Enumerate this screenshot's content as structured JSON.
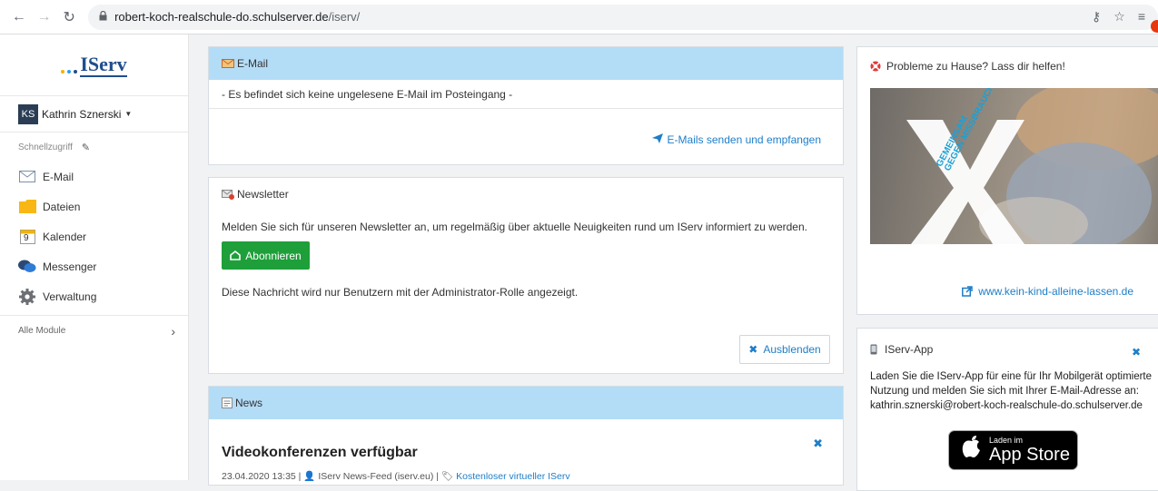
{
  "browser": {
    "url_host": "robert-koch-realschule-do.schulserver.de",
    "url_path": "/iserv/"
  },
  "sidebar": {
    "logo_text": "IServ",
    "user_initials": "KS",
    "user_name": "Kathrin Sznerski",
    "quick_access_label": "Schnellzugriff",
    "items": [
      {
        "label": "E-Mail",
        "icon": "envelope-icon"
      },
      {
        "label": "Dateien",
        "icon": "folder-icon"
      },
      {
        "label": "Kalender",
        "icon": "calendar-icon",
        "calendar_day": "9"
      },
      {
        "label": "Messenger",
        "icon": "chat-icon"
      },
      {
        "label": "Verwaltung",
        "icon": "gear-icon"
      }
    ],
    "all_modules_label": "Alle Module"
  },
  "email": {
    "title": "E-Mail",
    "status": "- Es befindet sich keine ungelesene E-Mail im Posteingang -",
    "link": "E-Mails senden und empfangen"
  },
  "newsletter": {
    "title": "Newsletter",
    "text": "Melden Sie sich für unseren Newsletter an, um regelmäßig über aktuelle Neuigkeiten rund um IServ informiert zu werden.",
    "subscribe_label": "Abonnieren",
    "admin_note": "Diese Nachricht wird nur Benutzern mit der Administrator-Rolle angezeigt.",
    "hide_label": "Ausblenden"
  },
  "news": {
    "title": "News",
    "headline": "Videokonferenzen verfügbar",
    "date": "23.04.2020 13:35 |",
    "author": "IServ News-Feed (iserv.eu) |",
    "tag": "Kostenloser virtueller IServ"
  },
  "help": {
    "title": "Probleme zu Hause? Lass dir helfen!",
    "image_caption_1": "GEMEINSAM",
    "image_caption_2": "GEGEN MISSBRAUCH",
    "link": "www.kein-kind-alleine-lassen.de"
  },
  "app": {
    "title": "IServ-App",
    "text_line_1": "Laden Sie die IServ-App für eine für Ihr Mobilgerät optimierte",
    "text_line_2": "Nutzung und melden Sie sich mit Ihrer E-Mail-Adresse an:",
    "text_line_3": "kathrin.sznerski@robert-koch-realschule-do.schulserver.de",
    "badge_small": "Laden im",
    "badge_big": "App Store"
  },
  "colors": {
    "accent_blue": "#1e7ec8",
    "header_blue": "#b3dcf7",
    "subscribe_green": "#1e9f3a"
  }
}
